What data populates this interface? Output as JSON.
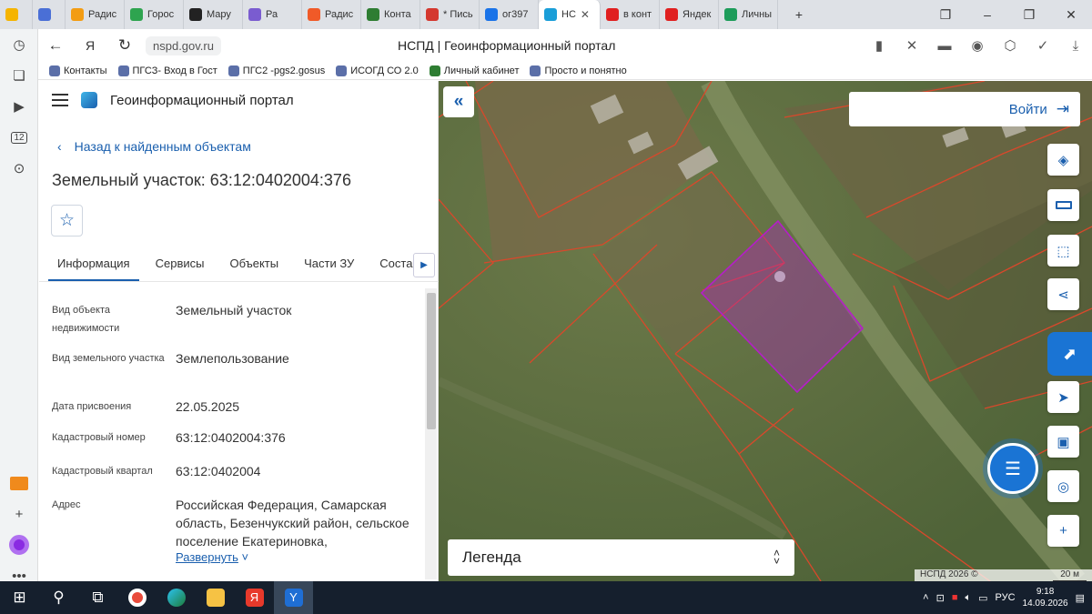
{
  "browser": {
    "tabs": [
      {
        "label": "",
        "color": "#f5b400"
      },
      {
        "label": "",
        "color": "#4a6fd6"
      },
      {
        "label": "Радис",
        "color": "#f39c12"
      },
      {
        "label": "Горос",
        "color": "#2ea44f"
      },
      {
        "label": "Мару",
        "color": "#222222"
      },
      {
        "label": "Ра",
        "color": "#7a5cd0"
      },
      {
        "label": "Радис",
        "color": "#f05a28"
      },
      {
        "label": "Конта",
        "color": "#2e7d32"
      },
      {
        "label": "* Пись",
        "color": "#d4382f"
      },
      {
        "label": "ог397",
        "color": "#1a73e8"
      },
      {
        "label": "НС",
        "color": "#1a9ed8"
      },
      {
        "label": "в конт",
        "color": "#e02020"
      },
      {
        "label": "Яндек",
        "color": "#e02020"
      },
      {
        "label": "Личны",
        "color": "#1d9c5a"
      }
    ],
    "active_tab_index": 10,
    "new_tab": "+",
    "window_controls": [
      "❐",
      "–",
      "❐",
      "✕"
    ],
    "url": "nspd.gov.ru",
    "page_title": "НСПД | Геоинформационный портал",
    "bookmarks": [
      {
        "label": "Контакты",
        "icon": "crest-icon"
      },
      {
        "label": "ПГСЗ- Вход в Гост",
        "icon": "crest-icon"
      },
      {
        "label": "ПГС2 -pgs2.gosus",
        "icon": "crest-icon"
      },
      {
        "label": "ИСОГД СО 2.0",
        "icon": "crest-icon"
      },
      {
        "label": "Личный кабинет",
        "icon": "shield-icon"
      },
      {
        "label": "Просто и понятно",
        "icon": "crest-icon"
      }
    ],
    "sidebar_badge": "12"
  },
  "app": {
    "brand": "Геоинформационный портал",
    "back_label": "Назад к найденным объектам",
    "object_title": "Земельный участок: 63:12:0402004:376",
    "tabs": [
      "Информация",
      "Сервисы",
      "Объекты",
      "Части ЗУ",
      "Состав"
    ],
    "active_tab": 0,
    "info_rows": [
      {
        "label": "Вид объекта недвижимости",
        "value": "Земельный участок"
      },
      {
        "label": "Вид земельного участка",
        "value": "Землепользование"
      },
      {
        "label": "Дата присвоения",
        "value": "22.05.2025"
      },
      {
        "label": "Кадастровый номер",
        "value": "63:12:0402004:376"
      },
      {
        "label": "Кадастровый квартал",
        "value": "63:12:0402004"
      },
      {
        "label": "Адрес",
        "value": "Российская Федерация, Самарская область, Безенчукский район, сельское поселение Екатериновка,"
      }
    ],
    "expand_label": "Развернуть",
    "accent_color": "#1a5fae"
  },
  "map": {
    "login_label": "Войти",
    "legend_label": "Легенда",
    "attribution": "НСПД 2026 ©",
    "scale_label": "20 м",
    "selected_parcel_color": "#b41ec8",
    "parcel_border_color": "#d9482b",
    "tools": [
      "layers-icon",
      "ruler-icon",
      "select-area-icon",
      "share-icon",
      "navigate-icon",
      "print-icon",
      "location-icon",
      "zoom-in-icon"
    ]
  },
  "taskbar": {
    "lang": "РУС",
    "time": "9:18",
    "date": "14.09.2026"
  }
}
